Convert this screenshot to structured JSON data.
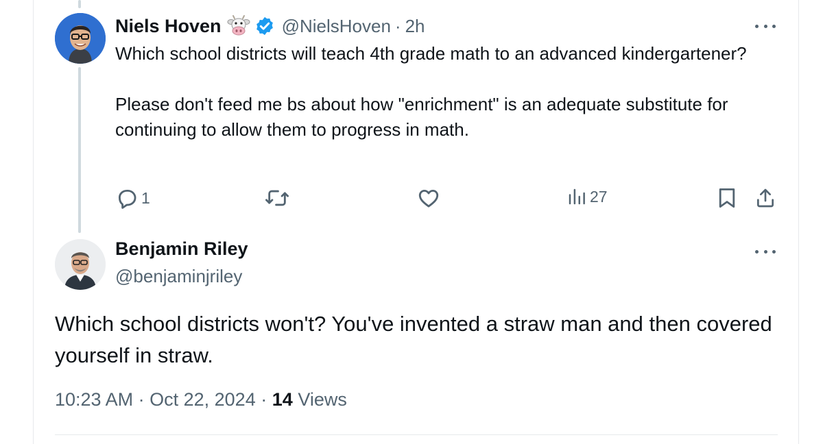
{
  "original_tweet": {
    "author_name": "Niels Hoven",
    "handle": "@NielsHoven",
    "separator": "·",
    "time": "2h",
    "badge_emoji": "cow-face-icon",
    "verified": true,
    "paragraphs": [
      "Which school districts will teach 4th grade math to an advanced kindergartener?",
      "Please don't feed me bs about how \"enrichment\" is an adequate substitute for continuing to allow them to progress in math."
    ],
    "reply_count": "1",
    "view_count": "27"
  },
  "reply_tweet": {
    "author_name": "Benjamin Riley",
    "handle": "@benjaminjriley",
    "text": "Which school districts won't? You've invented a straw man and then covered yourself in straw.",
    "time": "10:23 AM",
    "separator": "·",
    "date": "Oct 22, 2024",
    "view_count": "14",
    "views_label": "Views"
  },
  "colors": {
    "text": "#0f1419",
    "secondary": "#536471",
    "verified_blue": "#1d9bf0",
    "thread_line": "#cfd9de"
  }
}
